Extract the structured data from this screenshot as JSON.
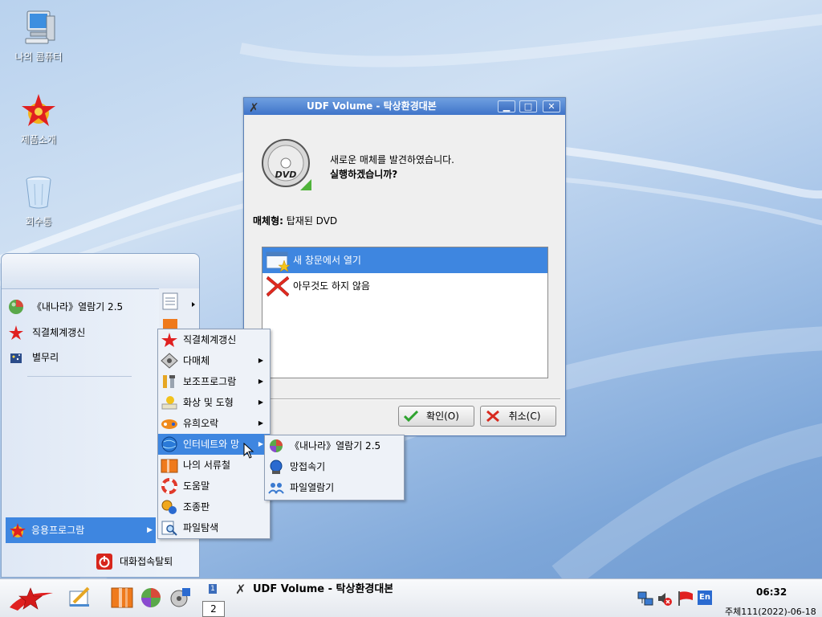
{
  "desktop": {
    "icons": [
      {
        "label": "나의 콤퓨터",
        "icon": "computer-icon"
      },
      {
        "label": "제품소개",
        "icon": "red-star-icon"
      },
      {
        "label": "회수통",
        "icon": "trash-icon"
      }
    ]
  },
  "dialog": {
    "title": "UDF Volume - 탁상환경대본",
    "message_line1": "새로운 매체를 발견하였습니다.",
    "message_line2": "실행하겠습니까?",
    "media_type_label": "매체형:",
    "media_type_value": " 탑재된 DVD",
    "actions": [
      {
        "label": "새 창문에서 열기",
        "icon": "folder-open-icon",
        "selected": true
      },
      {
        "label": "아무것도 하지 않음",
        "icon": "red-x-icon",
        "selected": false
      }
    ],
    "ok_label": "확인(O)",
    "cancel_label": "취소(C)",
    "window_buttons": {
      "minimize": "▁",
      "maximize": "□",
      "close": "✕"
    },
    "dvd_label": "DVD"
  },
  "start_menu": {
    "items": [
      {
        "label": "《내나라》열람기 2.5",
        "icon": "globe-icon"
      },
      {
        "label": "직결체계갱신",
        "icon": "red-star-icon"
      },
      {
        "label": "별무리",
        "icon": "star-cluster-icon"
      }
    ],
    "apps_label": "응용프로그람",
    "logout_label": "대화접속탈퇴"
  },
  "apps_submenu": {
    "items": [
      {
        "label": "직결체계갱신",
        "arrow": false,
        "selected": false
      },
      {
        "label": "다매체",
        "arrow": true,
        "selected": false
      },
      {
        "label": "보조프로그람",
        "arrow": true,
        "selected": false
      },
      {
        "label": "화상 및 도형",
        "arrow": true,
        "selected": false
      },
      {
        "label": "유희오락",
        "arrow": true,
        "selected": false
      },
      {
        "label": "인터네트와 망",
        "arrow": true,
        "selected": true
      },
      {
        "label": "나의 서류철",
        "arrow": false,
        "selected": false
      },
      {
        "label": "도움말",
        "arrow": false,
        "selected": false
      },
      {
        "label": "조종판",
        "arrow": false,
        "selected": false
      },
      {
        "label": "파일탐색",
        "arrow": false,
        "selected": false
      }
    ]
  },
  "internet_submenu": {
    "items": [
      {
        "label": "《내나라》열람기 2.5"
      },
      {
        "label": "망접속기"
      },
      {
        "label": "파일열람기"
      }
    ]
  },
  "taskbar": {
    "pager_1": "1",
    "pager_2": "2",
    "task_title": "UDF Volume - 탁상환경대본",
    "clock": "06:32",
    "date": "주체111(2022)-06-18",
    "lang": "En"
  }
}
